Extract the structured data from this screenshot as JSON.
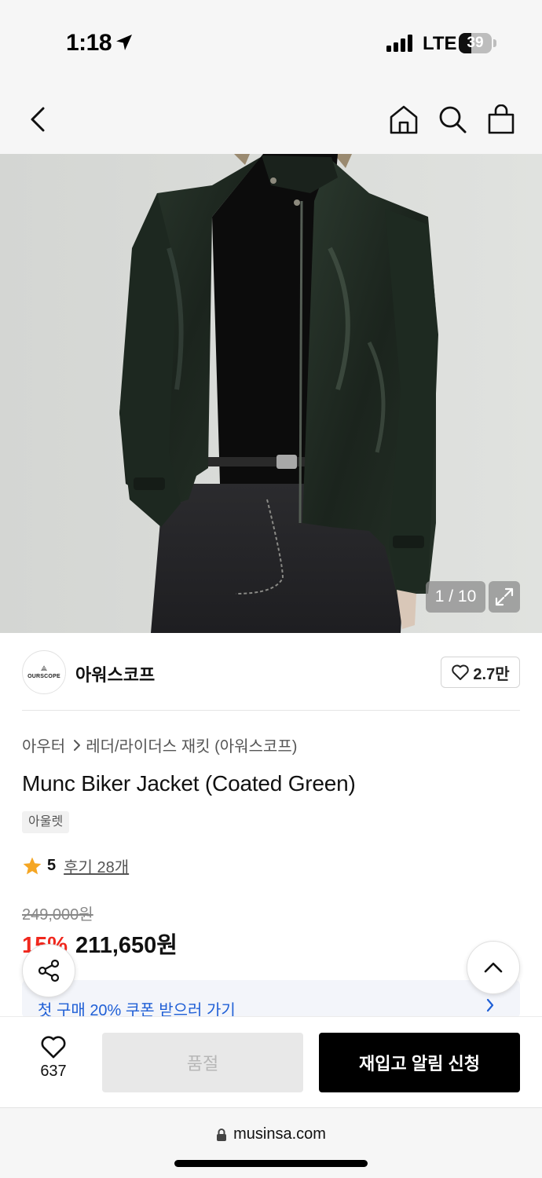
{
  "status_bar": {
    "time": "1:18",
    "network": "LTE",
    "battery": "39",
    "battery_level": 0.39,
    "icons": [
      "location-arrow-icon",
      "signal-bars-icon",
      "battery-icon"
    ]
  },
  "nav": {
    "icons": [
      "back-chevron-icon",
      "home-icon",
      "search-icon",
      "shopping-bag-icon"
    ]
  },
  "hero": {
    "image_counter": "1 / 10",
    "expand_icon": "expand-icon"
  },
  "brand": {
    "logo_text": "OURSCOPE",
    "name": "아워스코프",
    "likes": "2.7만",
    "like_icon": "heart-outline-icon"
  },
  "product": {
    "breadcrumb": [
      "아우터",
      "레더/라이더스 재킷 (아워스코프)"
    ],
    "title": "Munc Biker Jacket (Coated Green)",
    "tag": "아울렛",
    "rating": "5",
    "review_link": "후기 28개",
    "star_color": "#f5a623",
    "original_price": "249,000원",
    "discount": "15%",
    "discount_color": "#f0281e",
    "sale_price": "211,650원"
  },
  "coupon": {
    "text": "첫 구매 20% 쿠폰 받으러 가기",
    "color": "#1f5fd6"
  },
  "floating": {
    "share_icon": "share-icon",
    "top_icon": "chevron-up-icon"
  },
  "actions": {
    "wish_count": "637",
    "soldout_label": "품절",
    "restock_label": "재입고 알림 신청"
  },
  "browser": {
    "url": "musinsa.com",
    "lock_icon": "lock-icon"
  }
}
